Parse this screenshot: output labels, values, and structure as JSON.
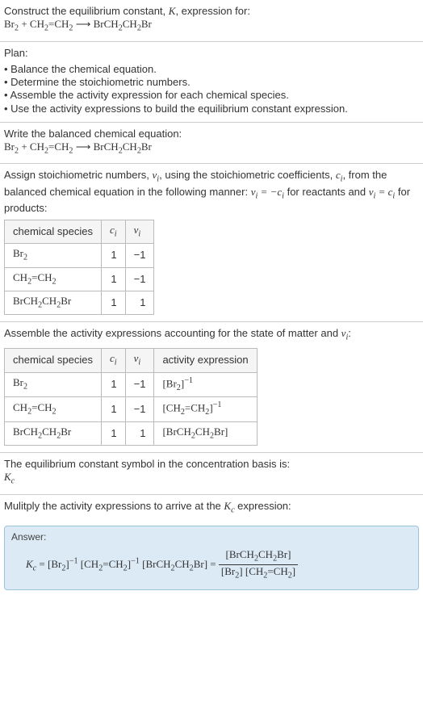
{
  "s1": {
    "t": "Construct the equilibrium constant, ",
    "k": "K",
    "t2": ", expression for:"
  },
  "eq": {
    "r1": "Br",
    "r1s": "2",
    "plus": " + ",
    "r2a": "CH",
    "r2b": "=CH",
    "arrow": " ⟶ ",
    "p": "BrCH",
    "p2": "CH",
    "p3": "Br"
  },
  "s2": {
    "h": "Plan:",
    "b1": "Balance the chemical equation.",
    "b2": "Determine the stoichiometric numbers.",
    "b3": "Assemble the activity expression for each chemical species.",
    "b4": "Use the activity expressions to build the equilibrium constant expression."
  },
  "s3": {
    "h": "Write the balanced chemical equation:"
  },
  "s4": {
    "t1": "Assign stoichiometric numbers, ",
    "nu": "ν",
    "isub": "i",
    "t2": ", using the stoichiometric coefficients, ",
    "c": "c",
    "t3": ", from the balanced chemical equation in the following manner: ",
    "eqn1": " = −",
    "t4": " for reactants and ",
    "eqn2": " = ",
    "t5": " for products:"
  },
  "tbl1": {
    "h1": "chemical species",
    "h2": "c",
    "h3": "ν",
    "rows": [
      {
        "sp": "Br",
        "sub": "2",
        "c": "1",
        "n": "−1"
      },
      {
        "spA": "CH",
        "spB": "=CH",
        "sub": "2",
        "c": "1",
        "n": "−1"
      },
      {
        "spA": "BrCH",
        "spB": "CH",
        "spC": "Br",
        "sub": "2",
        "c": "1",
        "n": "1"
      }
    ]
  },
  "s5": {
    "t": "Assemble the activity expressions accounting for the state of matter and ",
    "nu": "ν",
    "isub": "i",
    "colon": ":"
  },
  "tbl2": {
    "h1": "chemical species",
    "h2": "c",
    "h3": "ν",
    "h4": "activity expression",
    "a1sup": "−1",
    "a2sup": "−1"
  },
  "s6": {
    "t": "The equilibrium constant symbol in the concentration basis is:",
    "k": "K",
    "ksub": "c"
  },
  "s7": {
    "t": "Mulitply the activity expressions to arrive at the ",
    "k": "K",
    "ksub": "c",
    "t2": " expression:"
  },
  "ans": {
    "lbl": "Answer:",
    "Kc": "K",
    "Kcsub": "c",
    "eq": " = ",
    "sup": "−1"
  }
}
